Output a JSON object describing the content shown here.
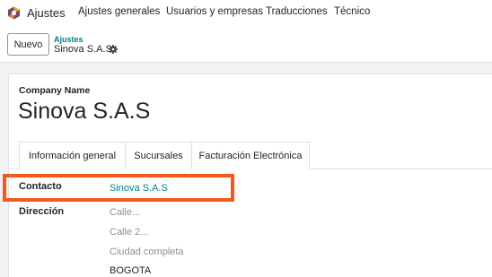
{
  "navbar": {
    "app_name": "Ajustes",
    "items": [
      {
        "label": "Ajustes generales"
      },
      {
        "label": "Usuarios y empresas"
      },
      {
        "label": "Traducciones"
      },
      {
        "label": "Técnico"
      }
    ]
  },
  "control_panel": {
    "new_button": "Nuevo",
    "breadcrumb_parent": "Ajustes",
    "breadcrumb_current": "Sinova S.A.S"
  },
  "form": {
    "company_name_label": "Company Name",
    "company_name": "Sinova S.A.S",
    "tabs": [
      {
        "label": "Información general",
        "active": true
      },
      {
        "label": "Sucursales",
        "active": false
      },
      {
        "label": "Facturación Electrónica",
        "active": false
      }
    ],
    "contact_label": "Contacto",
    "contact_value": "Sinova S.A.S",
    "address_label": "Dirección",
    "street_placeholder": "Calle...",
    "street2_placeholder": "Calle 2...",
    "city_placeholder": "Ciudad completa",
    "state_value": "BOGOTA"
  },
  "colors": {
    "accent": "#017e84",
    "highlight": "#f15a1c",
    "logo_primary": "#714b67",
    "logo_secondary": "#f9a825"
  }
}
